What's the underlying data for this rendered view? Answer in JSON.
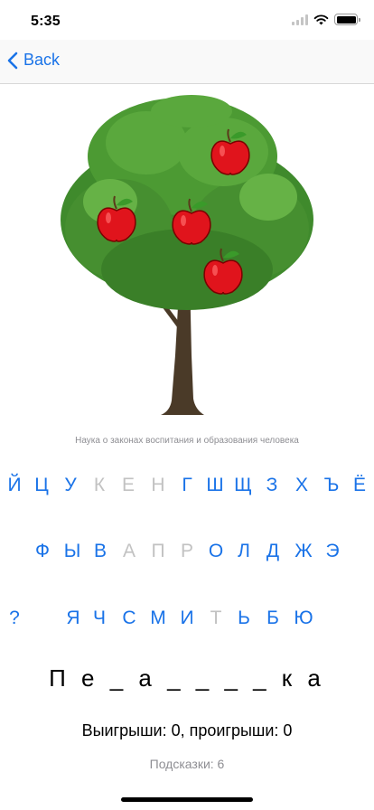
{
  "status_bar": {
    "time": "5:35"
  },
  "nav": {
    "back_label": "Back"
  },
  "game": {
    "hint_text": "Наука о законах воспитания и образования человека",
    "word": "П е _ а _ _ _ _ к а",
    "score": "Выигрыши: 0, проигрыши: 0",
    "hints": "Подсказки: 6",
    "apples_remaining": 4
  },
  "keyboard": {
    "row1": [
      {
        "label": "Й",
        "used": false
      },
      {
        "label": "Ц",
        "used": false
      },
      {
        "label": "У",
        "used": false
      },
      {
        "label": "К",
        "used": true
      },
      {
        "label": "Е",
        "used": true
      },
      {
        "label": "Н",
        "used": true
      },
      {
        "label": "Г",
        "used": false
      },
      {
        "label": "Ш",
        "used": false
      },
      {
        "label": "Щ",
        "used": false
      },
      {
        "label": "З",
        "used": false
      },
      {
        "label": "Х",
        "used": false
      },
      {
        "label": "Ъ",
        "used": false
      },
      {
        "label": "Ё",
        "used": false
      }
    ],
    "row2": [
      {
        "label": "Ф",
        "used": false
      },
      {
        "label": "Ы",
        "used": false
      },
      {
        "label": "В",
        "used": false
      },
      {
        "label": "А",
        "used": true
      },
      {
        "label": "П",
        "used": true
      },
      {
        "label": "Р",
        "used": true
      },
      {
        "label": "О",
        "used": false
      },
      {
        "label": "Л",
        "used": false
      },
      {
        "label": "Д",
        "used": false
      },
      {
        "label": "Ж",
        "used": false
      },
      {
        "label": "Э",
        "used": false
      }
    ],
    "row3": [
      {
        "label": "?",
        "used": false
      },
      {
        "label": "Я",
        "used": false
      },
      {
        "label": "Ч",
        "used": false
      },
      {
        "label": "С",
        "used": false
      },
      {
        "label": "М",
        "used": false
      },
      {
        "label": "И",
        "used": false
      },
      {
        "label": "Т",
        "used": true
      },
      {
        "label": "Ь",
        "used": false
      },
      {
        "label": "Б",
        "used": false
      },
      {
        "label": "Ю",
        "used": false
      }
    ]
  },
  "colors": {
    "accent": "#1a73e8",
    "used_key": "#c2c2c2",
    "apple": "#e0141c",
    "leaf": "#3f8a2c"
  }
}
